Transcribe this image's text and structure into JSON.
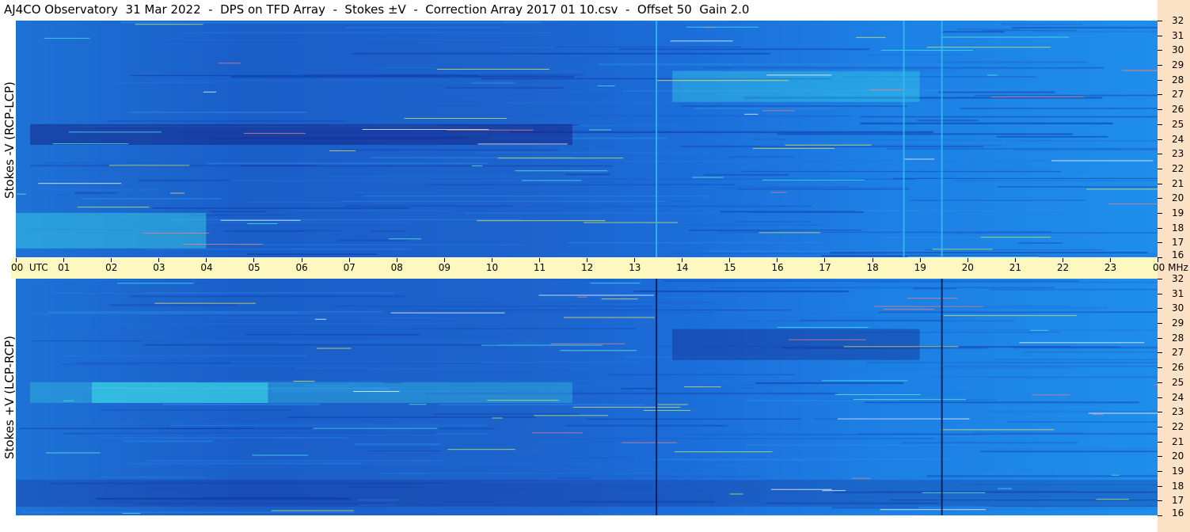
{
  "title": "AJ4CO Observatory  31 Mar 2022  -  DPS on TFD Array  -  Stokes ±V  -  Correction Array 2017 01 10.csv  -  Offset 50  Gain 2.0",
  "panels": {
    "top_label": "Stokes -V (RCP-LCP)",
    "bottom_label": "Stokes +V (LCP-RCP)"
  },
  "colors": {
    "background_blue": "#1a66d4",
    "dark_band": "#16288a",
    "bright_band": "#3ee0e8",
    "time_strip": "#fdf8bf",
    "freq_strip": "#fbe1c6"
  },
  "chart_data": {
    "type": "heatmap",
    "xlabel": "UTC",
    "ylabel_unit": "MHz",
    "x_tick_labels": [
      "00",
      "01",
      "02",
      "03",
      "04",
      "05",
      "06",
      "07",
      "08",
      "09",
      "10",
      "11",
      "12",
      "13",
      "14",
      "15",
      "16",
      "17",
      "18",
      "19",
      "20",
      "21",
      "22",
      "23",
      "00"
    ],
    "x_first_label": "00  UTC",
    "x_last_label": "00 MHz",
    "xlim": [
      0,
      24
    ],
    "y_tick_labels": [
      "32",
      "31",
      "30",
      "29",
      "28",
      "27",
      "26",
      "25",
      "24",
      "23",
      "22",
      "21",
      "20",
      "19",
      "18",
      "17",
      "16"
    ],
    "ylim": [
      16,
      32
    ],
    "panels": [
      {
        "name": "Stokes -V (RCP-LCP)",
        "vertical_lines_utc": [
          13.45,
          18.65,
          19.45
        ],
        "dark_bands": [
          {
            "utc_start": 0.3,
            "utc_end": 11.7,
            "mhz_low": 23.6,
            "mhz_high": 25.0,
            "intensity": 0.8
          }
        ],
        "bright_bands": [
          {
            "utc_start": 0.0,
            "utc_end": 4.0,
            "mhz_low": 16.6,
            "mhz_high": 19.0,
            "intensity": 0.7
          },
          {
            "utc_start": 13.8,
            "utc_end": 19.0,
            "mhz_low": 26.5,
            "mhz_high": 28.6,
            "intensity": 0.6
          }
        ]
      },
      {
        "name": "Stokes +V (LCP-RCP)",
        "vertical_lines_utc": [
          13.45,
          19.45
        ],
        "dark_bands": [
          {
            "utc_start": 13.8,
            "utc_end": 19.0,
            "mhz_low": 26.5,
            "mhz_high": 28.6,
            "intensity": 0.6
          },
          {
            "utc_start": 0.0,
            "utc_end": 24.0,
            "mhz_low": 16.6,
            "mhz_high": 18.4,
            "intensity": 0.4
          }
        ],
        "bright_bands": [
          {
            "utc_start": 1.6,
            "utc_end": 5.3,
            "mhz_low": 23.6,
            "mhz_high": 25.0,
            "intensity": 0.9
          },
          {
            "utc_start": 0.3,
            "utc_end": 11.7,
            "mhz_low": 23.6,
            "mhz_high": 25.0,
            "intensity": 0.5
          }
        ]
      }
    ]
  }
}
